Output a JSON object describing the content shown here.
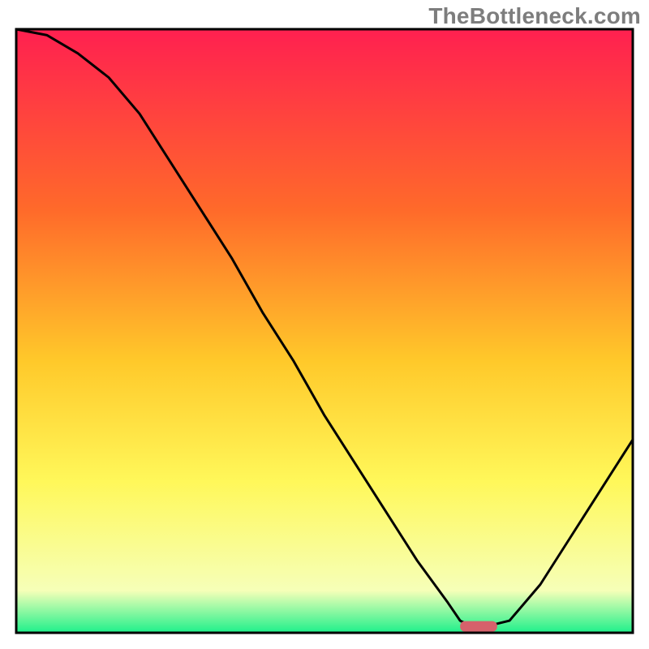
{
  "watermark": "TheBottleneck.com",
  "colors": {
    "gradient_top": "#ff2050",
    "gradient_mid1": "#ff6a2a",
    "gradient_mid2": "#ffc92a",
    "gradient_mid3": "#fff85a",
    "gradient_mid4": "#f6ffb8",
    "gradient_bottom": "#1ef08b",
    "curve": "#000000",
    "marker_fill": "#d6616b",
    "frame": "#000000"
  },
  "chart_data": {
    "type": "line",
    "title": "",
    "xlabel": "",
    "ylabel": "",
    "xlim": [
      0,
      100
    ],
    "ylim": [
      0,
      100
    ],
    "x": [
      0,
      5,
      10,
      15,
      20,
      25,
      30,
      35,
      40,
      45,
      50,
      55,
      60,
      65,
      70,
      72,
      74,
      76,
      80,
      85,
      90,
      95,
      100
    ],
    "values": [
      100,
      99,
      96,
      92,
      86,
      78,
      70,
      62,
      53,
      45,
      36,
      28,
      20,
      12,
      5,
      2,
      1,
      1,
      2,
      8,
      16,
      24,
      32
    ],
    "optimal_marker": {
      "x": 75,
      "y": 1,
      "width": 6
    },
    "axes_visible": false,
    "grid": false,
    "legend": false,
    "notes": "Background is a vertical red→yellow→green gradient; black curve dips to a minimum near x≈75% where a small rounded red marker sits, then rises toward bottom-right."
  }
}
